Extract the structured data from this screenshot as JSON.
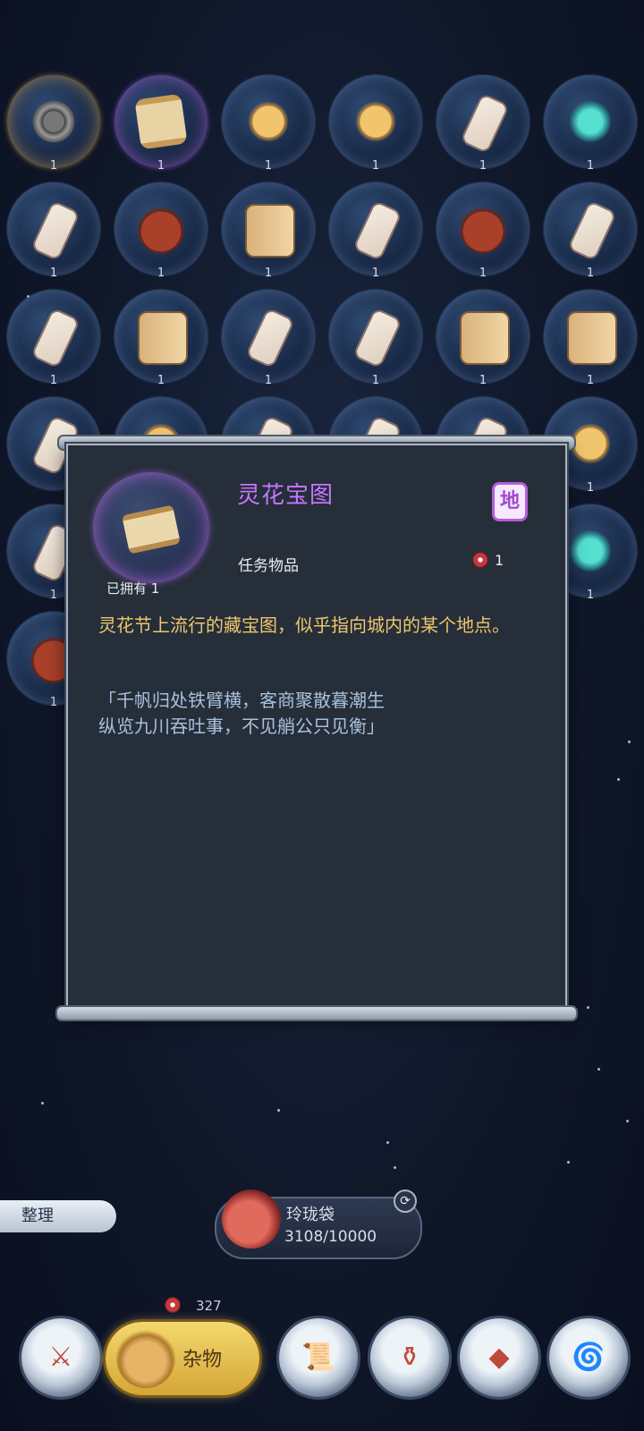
{
  "inventory": {
    "items": [
      {
        "icon": "gear-icon",
        "qty": "1",
        "rarity": "gold",
        "kind": "gear"
      },
      {
        "icon": "treasure-map-icon",
        "qty": "1",
        "rarity": "purple",
        "kind": "scroll"
      },
      {
        "icon": "amulet-icon",
        "qty": "1",
        "rarity": "blue",
        "kind": "amulet"
      },
      {
        "icon": "amulet-icon",
        "qty": "1",
        "rarity": "blue",
        "kind": "amulet"
      },
      {
        "icon": "flower-card-icon",
        "qty": "1",
        "rarity": "blue",
        "kind": "card"
      },
      {
        "icon": "gem-ornament-icon",
        "qty": "1",
        "rarity": "blue",
        "kind": "gem"
      },
      {
        "icon": "flower-card-icon",
        "qty": "1",
        "rarity": "blue",
        "kind": "card"
      },
      {
        "icon": "wine-jar-icon",
        "qty": "1",
        "rarity": "blue",
        "kind": "jar"
      },
      {
        "icon": "book-icon",
        "qty": "1",
        "rarity": "blue",
        "kind": "book"
      },
      {
        "icon": "flower-card-icon",
        "qty": "1",
        "rarity": "blue",
        "kind": "card"
      },
      {
        "icon": "wine-jar-icon",
        "qty": "1",
        "rarity": "blue",
        "kind": "jar"
      },
      {
        "icon": "flower-card-icon",
        "qty": "1",
        "rarity": "blue",
        "kind": "card"
      },
      {
        "icon": "flower-card-icon",
        "qty": "1",
        "rarity": "blue",
        "kind": "card"
      },
      {
        "icon": "book-icon",
        "qty": "1",
        "rarity": "blue",
        "kind": "book"
      },
      {
        "icon": "flower-card-icon",
        "qty": "1",
        "rarity": "blue",
        "kind": "card"
      },
      {
        "icon": "flower-card-icon",
        "qty": "1",
        "rarity": "blue",
        "kind": "card"
      },
      {
        "icon": "book-icon",
        "qty": "1",
        "rarity": "blue",
        "kind": "book"
      },
      {
        "icon": "book-icon",
        "qty": "1",
        "rarity": "blue",
        "kind": "book"
      },
      {
        "icon": "flower-card-icon",
        "qty": "",
        "rarity": "blue",
        "kind": "card"
      },
      {
        "icon": "item-icon",
        "qty": "",
        "rarity": "blue",
        "kind": "amulet"
      },
      {
        "icon": "flower-card-icon",
        "qty": "",
        "rarity": "blue",
        "kind": "card"
      },
      {
        "icon": "flower-card-icon",
        "qty": "",
        "rarity": "blue",
        "kind": "card"
      },
      {
        "icon": "flower-card-icon",
        "qty": "",
        "rarity": "blue",
        "kind": "card"
      },
      {
        "icon": "shell-icon",
        "qty": "1",
        "rarity": "blue",
        "kind": "amulet"
      },
      {
        "icon": "flower-card-icon",
        "qty": "1",
        "rarity": "blue",
        "kind": "card"
      },
      {
        "icon": "",
        "qty": "",
        "rarity": "blue",
        "kind": ""
      },
      {
        "icon": "",
        "qty": "",
        "rarity": "blue",
        "kind": ""
      },
      {
        "icon": "",
        "qty": "",
        "rarity": "blue",
        "kind": ""
      },
      {
        "icon": "",
        "qty": "",
        "rarity": "blue",
        "kind": ""
      },
      {
        "icon": "teapot-icon",
        "qty": "1",
        "rarity": "blue",
        "kind": "gem"
      },
      {
        "icon": "cauldron-icon",
        "qty": "1",
        "rarity": "blue",
        "kind": "jar"
      }
    ]
  },
  "detail": {
    "title": "灵花宝图",
    "grade_badge": "地",
    "category": "任务物品",
    "price": "1",
    "owned": "已拥有 1",
    "description": "灵花节上流行的藏宝图，似乎指向城内的某个地点。",
    "poem_line1": "「千帆归处铁臂横，客商聚散暮潮生",
    "poem_line2": "纵览九川吞吐事，不见艄公只见衡」",
    "title_color": "#c577ff"
  },
  "bottom": {
    "sort_label": "整理",
    "bag_name": "玲珑袋",
    "bag_capacity": "3108/10000",
    "currency_count": "327",
    "active_tab_label": "杂物"
  }
}
